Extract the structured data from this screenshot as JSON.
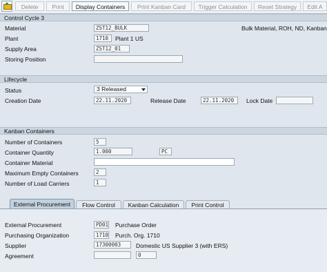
{
  "toolbar": {
    "icon": "change-display-icon",
    "buttons": [
      {
        "label": "Delete"
      },
      {
        "label": "Print"
      },
      {
        "label": "Display Containers"
      },
      {
        "label": "Print Kanban Card"
      },
      {
        "label": "Trigger Calculation"
      },
      {
        "label": "Reset Strategy"
      },
      {
        "label": "Edit A"
      }
    ]
  },
  "control_cycle": {
    "header": "Control Cycle 3",
    "material_label": "Material",
    "material_value": "ZST12_BULK",
    "material_desc": "Bulk Material, ROH, ND, Kanban",
    "plant_label": "Plant",
    "plant_value": "1710",
    "plant_desc": "Plant 1 US",
    "supply_area_label": "Supply Area",
    "supply_area_value": "ZST12_01",
    "storing_position_label": "Storing Position",
    "storing_position_value": ""
  },
  "lifecycle": {
    "header": "Lifecycle",
    "status_label": "Status",
    "status_value": "3 Released",
    "creation_date_label": "Creation Date",
    "creation_date_value": "22.11.2020",
    "release_date_label": "Release Date",
    "release_date_value": "22.11.2020",
    "lock_date_label": "Lock Date",
    "lock_date_value": ""
  },
  "kanban_containers": {
    "header": "Kanban Containers",
    "number_label": "Number of Containers",
    "number_value": "5",
    "quantity_label": "Container Quantity",
    "quantity_value": "1.000",
    "quantity_unit": "PC",
    "material_label": "Container Material",
    "material_value": "",
    "max_empty_label": "Maximum Empty Containers",
    "max_empty_value": "2",
    "load_carriers_label": "Number of Load Carriers",
    "load_carriers_value": "1"
  },
  "tabs": [
    {
      "label": "External Procurement"
    },
    {
      "label": "Flow Control"
    },
    {
      "label": "Kanban Calculation"
    },
    {
      "label": "Print Control"
    }
  ],
  "external_procurement": {
    "ext_proc_label": "External Procurement",
    "ext_proc_value": "PD01",
    "ext_proc_desc": "Purchase Order",
    "purch_org_label": "Purchasing Organization",
    "purch_org_value": "1710",
    "purch_org_desc": "Purch. Org. 1710",
    "supplier_label": "Supplier",
    "supplier_value": "17300003",
    "supplier_desc": "Domestic US Supplier 3 (with ERS)",
    "agreement_label": "Agreement",
    "agreement_value": "",
    "agreement_item": "0"
  }
}
